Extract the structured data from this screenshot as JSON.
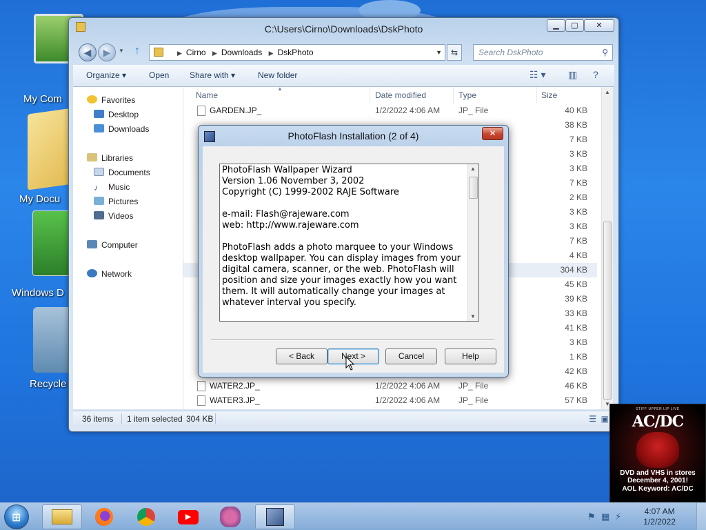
{
  "desktop": {
    "icons": [
      {
        "label": "My Com"
      },
      {
        "label": "My Docu"
      },
      {
        "label": "Windows D"
      },
      {
        "label": "Recycle"
      }
    ]
  },
  "explorer": {
    "title": "C:\\Users\\Cirno\\Downloads\\DskPhoto",
    "address": {
      "crumbs": [
        "Cirno",
        "Downloads",
        "DskPhoto"
      ]
    },
    "search_placeholder": "Search DskPhoto",
    "toolbar": {
      "organize": "Organize",
      "open": "Open",
      "share_with": "Share with",
      "new_folder": "New folder"
    },
    "nav": {
      "favorites": "Favorites",
      "desktop": "Desktop",
      "downloads": "Downloads",
      "libraries": "Libraries",
      "documents": "Documents",
      "music": "Music",
      "pictures": "Pictures",
      "videos": "Videos",
      "computer": "Computer",
      "network": "Network"
    },
    "columns": {
      "name": "Name",
      "date": "Date modified",
      "type": "Type",
      "size": "Size"
    },
    "files": [
      {
        "name": "GARDEN.JP_",
        "date": "1/2/2022 4:06 AM",
        "type": "JP_ File",
        "size": "40 KB"
      },
      {
        "name": "",
        "date": "",
        "type": "",
        "size": "38 KB"
      },
      {
        "name": "",
        "date": "",
        "type": "",
        "size": "7 KB"
      },
      {
        "name": "",
        "date": "",
        "type": "",
        "size": "3 KB"
      },
      {
        "name": "",
        "date": "",
        "type": "",
        "size": "3 KB"
      },
      {
        "name": "",
        "date": "",
        "type": "",
        "size": "7 KB"
      },
      {
        "name": "",
        "date": "",
        "type": "",
        "size": "2 KB"
      },
      {
        "name": "",
        "date": "",
        "type": "",
        "size": "3 KB"
      },
      {
        "name": "",
        "date": "",
        "type": "",
        "size": "3 KB"
      },
      {
        "name": "",
        "date": "",
        "type": "",
        "size": "7 KB"
      },
      {
        "name": "",
        "date": "",
        "type": "",
        "size": "4 KB"
      },
      {
        "name": "",
        "date": "",
        "type": "",
        "size": "304 KB"
      },
      {
        "name": "",
        "date": "",
        "type": "",
        "size": "45 KB"
      },
      {
        "name": "",
        "date": "",
        "type": "",
        "size": "39 KB"
      },
      {
        "name": "",
        "date": "",
        "type": "",
        "size": "33 KB"
      },
      {
        "name": "",
        "date": "",
        "type": "",
        "size": "41 KB"
      },
      {
        "name": "",
        "date": "",
        "type": "",
        "size": "3 KB"
      },
      {
        "name": "",
        "date": "",
        "type": "",
        "size": "1 KB"
      },
      {
        "name": "",
        "date": "",
        "type": "",
        "size": "42 KB"
      },
      {
        "name": "WATER2.JP_",
        "date": "1/2/2022 4:06 AM",
        "type": "JP_ File",
        "size": "46 KB"
      },
      {
        "name": "WATER3.JP_",
        "date": "1/2/2022 4:06 AM",
        "type": "JP_ File",
        "size": "57 KB"
      }
    ],
    "status": {
      "items": "36 items",
      "selected": "1 item selected",
      "selected_size": "304 KB"
    }
  },
  "dialog": {
    "title": "PhotoFlash Installation (2 of 4)",
    "lines": [
      "PhotoFlash Wallpaper Wizard",
      "Version 1.06 November 3, 2002",
      "Copyright (C) 1999-2002 RAJE Software"
    ],
    "contact": [
      "e-mail: Flash@rajeware.com",
      "web: http://www.rajeware.com"
    ],
    "description": "PhotoFlash adds a photo marquee to your Windows desktop wallpaper.  You can display images from your digital camera, scanner, or the web. PhotoFlash will position and size your images exactly how you want them. It will automatically change your images at whatever interval you specify.",
    "buttons": {
      "back": "< Back",
      "next": "Next >",
      "cancel": "Cancel",
      "help": "Help"
    }
  },
  "ad": {
    "tagline": "STIFF UPPER LIP LIVE",
    "logo": "AC/DC",
    "line1": "DVD and VHS in stores",
    "line2": "December 4, 2001!",
    "line3": "AOL Keyword: AC/DC"
  },
  "taskbar": {
    "clock_time": "4:07 AM",
    "clock_date": "1/2/2022"
  }
}
